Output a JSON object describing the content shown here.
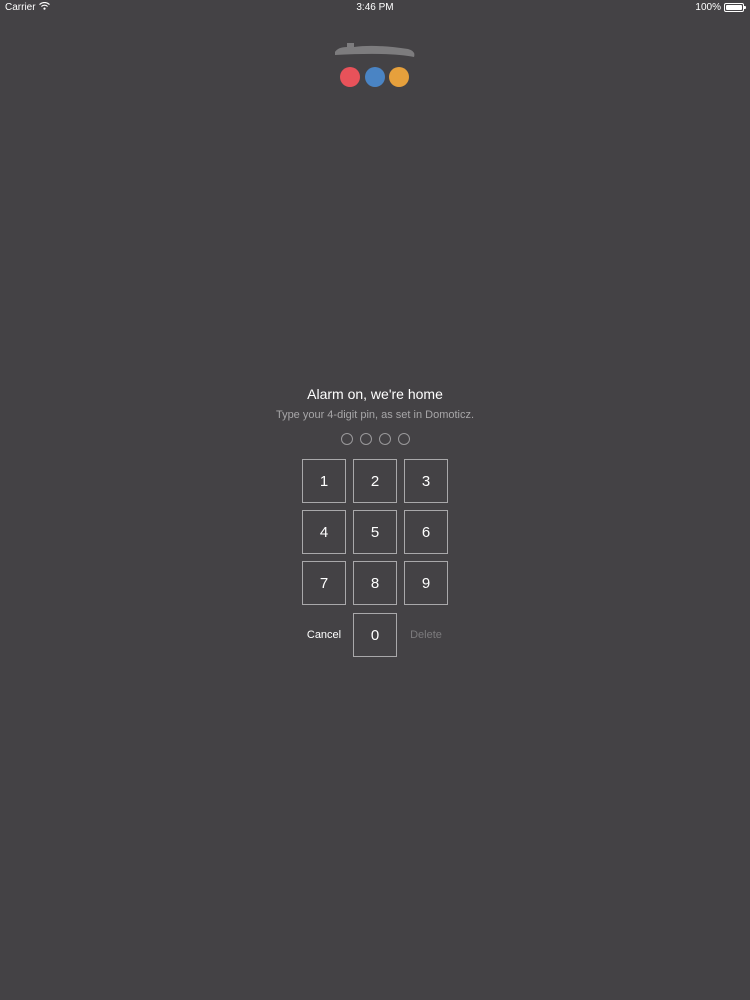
{
  "status_bar": {
    "carrier": "Carrier",
    "time": "3:46 PM",
    "battery": "100%",
    "battery_level": 1.0
  },
  "logo": {
    "colors": [
      "#e8525a",
      "#4a84c4",
      "#e6a03c"
    ],
    "roof_color": "#7d7c7e"
  },
  "lock": {
    "title": "Alarm on, we're home",
    "subtitle": "Type your 4-digit pin, as set in Domoticz.",
    "pin_length": 4
  },
  "keypad": {
    "keys": [
      "1",
      "2",
      "3",
      "4",
      "5",
      "6",
      "7",
      "8",
      "9",
      "0"
    ],
    "cancel_label": "Cancel",
    "delete_label": "Delete"
  }
}
